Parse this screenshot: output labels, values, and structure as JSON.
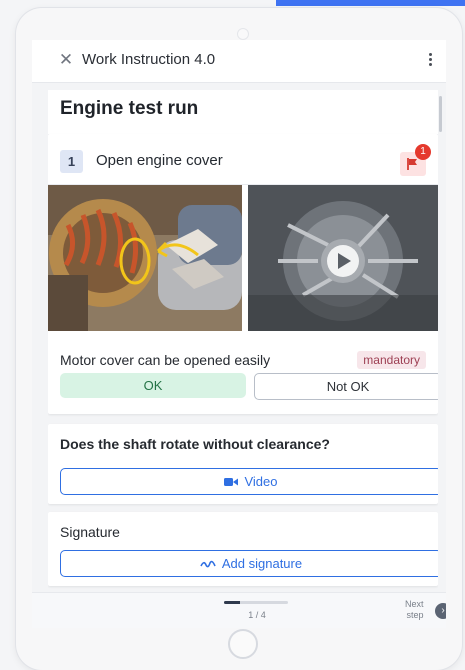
{
  "header": {
    "close_icon": "close-icon",
    "title": "Work Instruction 4.0",
    "menu_icon": "kebab-menu-icon"
  },
  "page": {
    "title": "Engine test run"
  },
  "step": {
    "number": "1",
    "title": "Open engine cover",
    "flag_count": "1",
    "flag_icon": "flag-icon",
    "media": [
      {
        "type": "image",
        "icon": "motor-coil-image"
      },
      {
        "type": "video",
        "icon": "play-icon"
      }
    ],
    "check": {
      "label": "Motor cover can be opened easily",
      "badge": "mandatory",
      "ok_label": "OK",
      "not_ok_label": "Not OK"
    }
  },
  "cards": [
    {
      "label": "Does the shaft rotate without clearance?",
      "button_label": "Video",
      "button_icon": "video-camera-icon"
    },
    {
      "label": "Signature",
      "button_label": "Add signature",
      "button_icon": "signature-icon"
    }
  ],
  "footer": {
    "progress": 0.25,
    "page": "1 / 4",
    "next_label_line1": "Next",
    "next_label_line2": "step",
    "next_icon": "chevron-right-icon"
  },
  "colors": {
    "accent": "#2f6fe2",
    "ok_bg": "#d8f3e4",
    "flag_bg": "#fde2e2",
    "flag_badge": "#e5392d"
  }
}
